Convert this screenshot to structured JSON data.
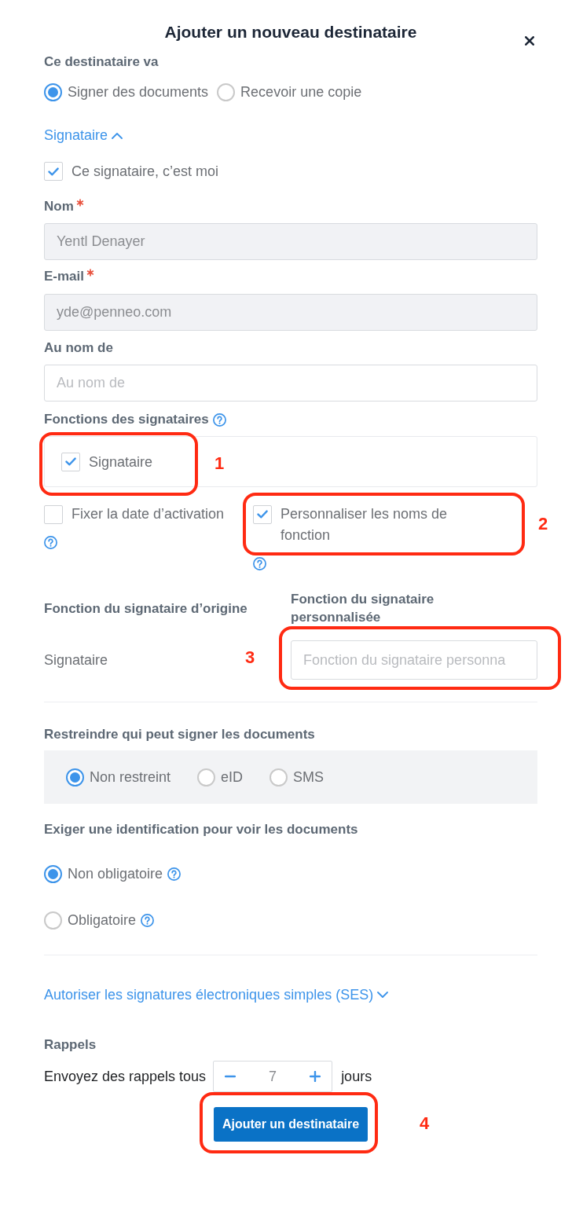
{
  "dialog": {
    "title": "Ajouter un nouveau destinataire"
  },
  "recipient_role": {
    "label": "Ce destinataire va",
    "options": [
      {
        "label": "Signer des documents",
        "selected": true
      },
      {
        "label": "Recevoir une copie",
        "selected": false
      }
    ]
  },
  "signer_section": {
    "label": "Signataire",
    "expanded": true
  },
  "self_signer": {
    "label": "Ce signataire, c’est moi",
    "checked": true
  },
  "fields": [
    {
      "label": "Nom",
      "required": true,
      "value": "Yentl Denayer",
      "disabled": true
    },
    {
      "label": "E-mail",
      "required": true,
      "value": "yde@penneo.com",
      "disabled": true
    },
    {
      "label": "Au nom de",
      "placeholder": "Au nom de",
      "disabled": false
    }
  ],
  "signer_functions": {
    "label": "Fonctions des signataires",
    "help": true,
    "options": [
      {
        "label": "Signataire",
        "checked": true
      }
    ],
    "annotation": "1"
  },
  "settings": [
    {
      "label": "Fixer la date d’activation",
      "checked": false,
      "help": true
    },
    {
      "label": "Personnaliser les noms de fonction",
      "checked": true,
      "help": true,
      "annotation": "2"
    }
  ],
  "function_names": {
    "columns": [
      "Fonction du signataire d’origine",
      "Fonction du signataire personnalisée"
    ],
    "rows": [
      {
        "original": "Signataire",
        "placeholder": "Fonction du signataire personna",
        "annotation": "3"
      }
    ]
  },
  "signing_restriction": {
    "label": "Restreindre qui peut signer les documents",
    "options": [
      {
        "label": "Non restreint",
        "selected": true
      },
      {
        "label": "eID",
        "selected": false
      },
      {
        "label": "SMS",
        "selected": false
      }
    ]
  },
  "view_identification": {
    "label": "Exiger une identification pour voir les documents",
    "options": [
      {
        "label": "Non obligatoire",
        "selected": true,
        "help": true
      },
      {
        "label": "Obligatoire",
        "selected": false,
        "help": true
      }
    ]
  },
  "ses_section": {
    "label": "Autoriser les signatures électroniques simples (SES)",
    "expanded": false
  },
  "reminders": {
    "label": "Rappels",
    "text_before": "Envoyez des rappels tous",
    "value": "7",
    "text_after": "jours"
  },
  "submit_button": {
    "label": "Ajouter un destinataire",
    "annotation": "4"
  }
}
